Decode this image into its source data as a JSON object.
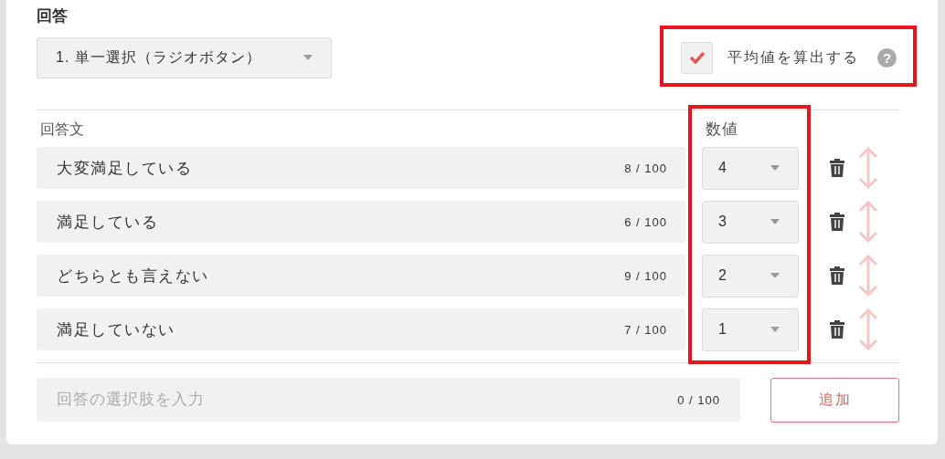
{
  "section_title": "回答",
  "question_type": {
    "value": "1. 単一選択（ラジオボタン）"
  },
  "average_option": {
    "label": "平均値を算出する",
    "checked": true,
    "help": "?"
  },
  "columns": [
    "回答文",
    "数値"
  ],
  "answers": [
    {
      "text": "大変満足している",
      "count": "8 / 100",
      "value": "4"
    },
    {
      "text": "満足している",
      "count": "6 / 100",
      "value": "3"
    },
    {
      "text": "どちらとも言えない",
      "count": "9 / 100",
      "value": "2"
    },
    {
      "text": "満足していない",
      "count": "7 / 100",
      "value": "1"
    }
  ],
  "new_answer": {
    "placeholder": "回答の選択肢を入力",
    "count": "0 / 100"
  },
  "add_button": "追加"
}
